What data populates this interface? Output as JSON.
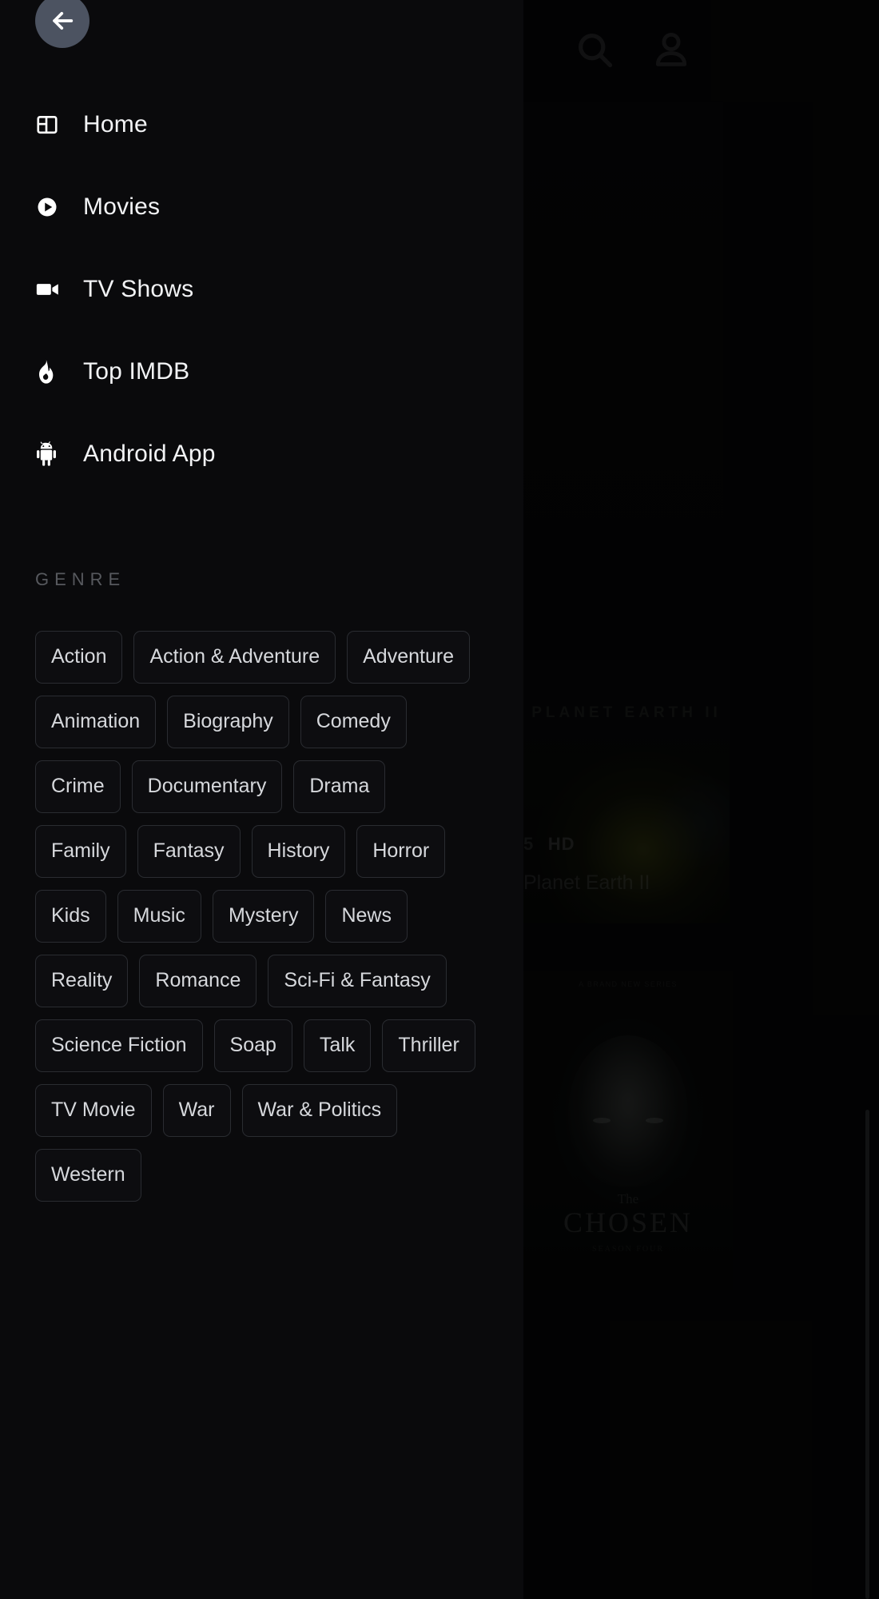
{
  "drawer": {
    "back_button": {
      "name": "back-arrow-icon",
      "label": "Back"
    },
    "nav_items": [
      {
        "label": "Home",
        "icon": "layout-columns-icon"
      },
      {
        "label": "Movies",
        "icon": "play-circle-icon"
      },
      {
        "label": "TV Shows",
        "icon": "video-camera-icon"
      },
      {
        "label": "Top IMDB",
        "icon": "flame-icon"
      },
      {
        "label": "Android App",
        "icon": "android-robot-icon"
      }
    ],
    "genre": {
      "heading": "GENRE",
      "chips": [
        "Action",
        "Action & Adventure",
        "Adventure",
        "Animation",
        "Biography",
        "Comedy",
        "Crime",
        "Documentary",
        "Drama",
        "Family",
        "Fantasy",
        "History",
        "Horror",
        "Kids",
        "Music",
        "Mystery",
        "News",
        "Reality",
        "Romance",
        "Sci-Fi & Fantasy",
        "Science Fiction",
        "Soap",
        "Talk",
        "Thriller",
        "TV Movie",
        "War",
        "War & Politics",
        "Western"
      ]
    }
  },
  "background": {
    "header": {
      "search_icon": "search-icon",
      "account_icon": "user-account-icon"
    },
    "featured": {
      "poster_wordmark": "PLANET EARTH II",
      "rating": "5",
      "quality_badge": "HD",
      "title": "Planet Earth II"
    },
    "second_card": {
      "credits_line": "A BRAND NEW SERIES",
      "title_prefix": "The",
      "title_main": "CHOSEN",
      "title_sub": "SEASON FOUR"
    }
  },
  "colors": {
    "page_background": "#09090b",
    "drawer_background": "#0a0a0c",
    "back_button_fill": "#4c5361",
    "nav_label": "#f2f3f5",
    "genre_heading": "#57595e",
    "chip_border": "#2a2c31",
    "chip_text": "#d6d8dc",
    "scrollbar_thumb": "#3a3d42"
  }
}
